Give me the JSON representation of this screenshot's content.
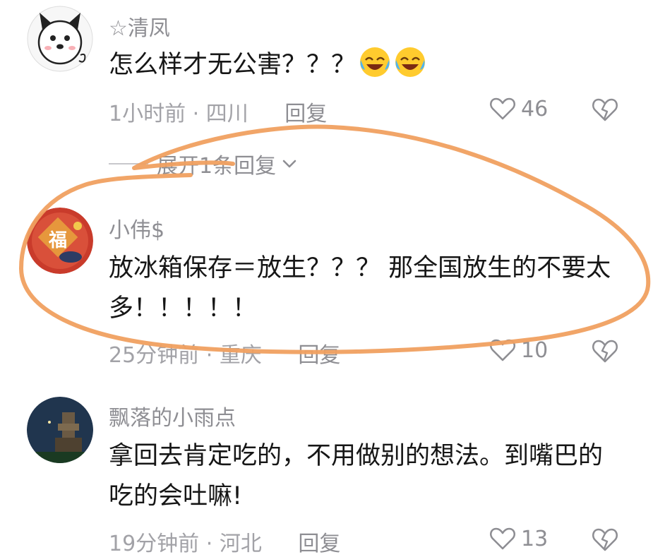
{
  "comments": [
    {
      "username": "☆清凤",
      "text": "怎么样才无公害？？？",
      "time": "1小时前",
      "location": "四川",
      "reply_label": "回复",
      "likes": "46",
      "emoji_count": 2
    },
    {
      "username": "小伟$",
      "text": "放冰箱保存＝放生？？？ 那全国放生的不要太多！！！！！",
      "time": "25分钟前",
      "location": "重庆",
      "reply_label": "回复",
      "likes": "10"
    },
    {
      "username": "飘落的小雨点",
      "text": "拿回去肯定吃的，不用做别的想法。到嘴巴的吃的会吐嘛!",
      "time": "19分钟前",
      "location": "河北",
      "reply_label": "回复",
      "likes": "13"
    }
  ],
  "expand_replies_label": "展开1条回复",
  "meta_separator": "·",
  "colors": {
    "annotation_stroke": "#f0a060",
    "secondary_text": "#8e8e93",
    "primary_text": "#161616"
  },
  "icons": [
    "heart-outline-icon",
    "broken-heart-icon",
    "chevron-down-icon",
    "laughing-emoji-icon"
  ]
}
